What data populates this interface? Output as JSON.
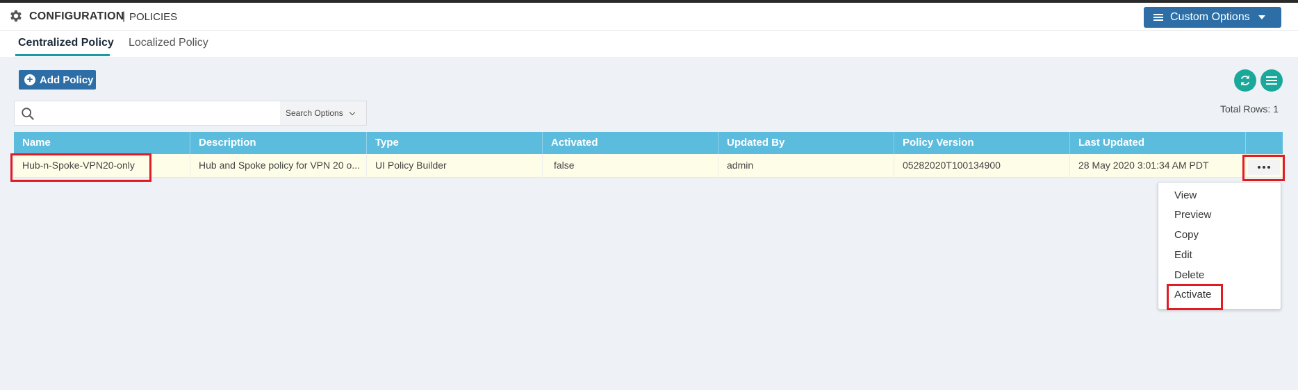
{
  "header": {
    "title": "CONFIGURATION",
    "separator": "|",
    "subtitle": "POLICIES",
    "custom_options_label": "Custom Options"
  },
  "tabs": [
    {
      "label": "Centralized Policy",
      "active": true
    },
    {
      "label": "Localized Policy",
      "active": false
    }
  ],
  "toolbar": {
    "add_policy_label": "Add Policy",
    "search_placeholder": "",
    "search_options_label": "Search Options",
    "total_rows_label": "Total Rows: 1"
  },
  "table": {
    "columns": [
      "Name",
      "Description",
      "Type",
      "Activated",
      "Updated By",
      "Policy Version",
      "Last Updated"
    ],
    "rows": [
      {
        "name": "Hub-n-Spoke-VPN20-only",
        "description": "Hub and Spoke policy for VPN 20 o...",
        "type": "UI Policy Builder",
        "activated": "false",
        "updated_by": "admin",
        "policy_version": "05282020T100134900",
        "last_updated": "28 May 2020 3:01:34 AM PDT"
      }
    ]
  },
  "context_menu": {
    "items": [
      "View",
      "Preview",
      "Copy",
      "Edit",
      "Delete",
      "Activate"
    ]
  },
  "colors": {
    "primary_button": "#2d6ea6",
    "table_header": "#5bbcde",
    "row_highlight": "#fdfde8",
    "annotation_red": "#e01b24",
    "teal": "#1aa89a"
  },
  "icons": [
    "gear-icon",
    "menu-lines-icon",
    "dropdown-caret-icon",
    "plus-circle-icon",
    "refresh-icon",
    "hamburger-icon",
    "search-icon",
    "chevron-down-icon",
    "more-dots-icon"
  ]
}
